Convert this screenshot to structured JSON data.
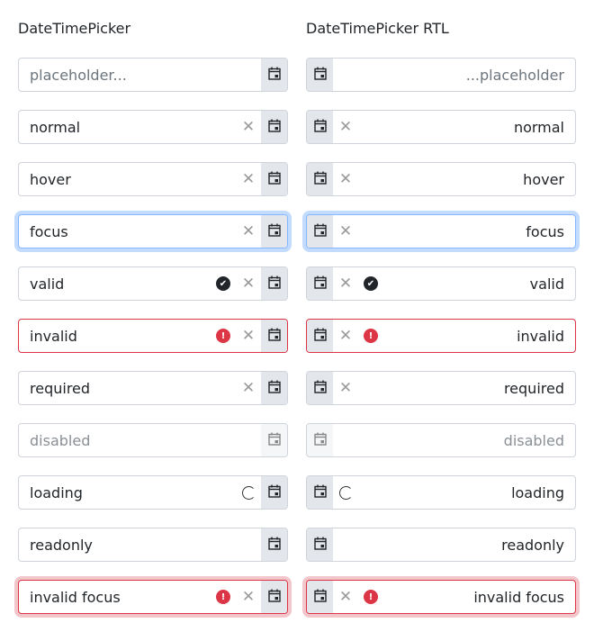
{
  "columns": [
    {
      "title": "DateTimePicker",
      "dir": "ltr"
    },
    {
      "title": "DateTimePicker RTL",
      "dir": "rtl"
    }
  ],
  "rows": [
    {
      "ltr": "placeholder...",
      "rtl": "...placeholder",
      "state": "placeholder",
      "icons": []
    },
    {
      "ltr": "normal",
      "rtl": "normal",
      "state": "normal",
      "icons": [
        "clear"
      ]
    },
    {
      "ltr": "hover",
      "rtl": "hover",
      "state": "hover",
      "icons": [
        "clear"
      ]
    },
    {
      "ltr": "focus",
      "rtl": "focus",
      "state": "focus",
      "icons": [
        "clear"
      ]
    },
    {
      "ltr": "valid",
      "rtl": "valid",
      "state": "valid",
      "icons": [
        "valid",
        "clear"
      ]
    },
    {
      "ltr": "invalid",
      "rtl": "invalid",
      "state": "invalid",
      "icons": [
        "invalid",
        "clear"
      ]
    },
    {
      "ltr": "required",
      "rtl": "required",
      "state": "required",
      "icons": [
        "clear"
      ]
    },
    {
      "ltr": "disabled",
      "rtl": "disabled",
      "state": "disabled",
      "icons": []
    },
    {
      "ltr": "loading",
      "rtl": "loading",
      "state": "loading",
      "icons": [
        "loading"
      ]
    },
    {
      "ltr": "readonly",
      "rtl": "readonly",
      "state": "readonly",
      "icons": []
    },
    {
      "ltr": "invalid focus",
      "rtl": "invalid focus",
      "state": "invalidfocus",
      "icons": [
        "invalid",
        "clear"
      ]
    }
  ],
  "colors": {
    "invalid": "#dc3545",
    "focus": "#86b7fe",
    "button": "#e3e6ea"
  }
}
